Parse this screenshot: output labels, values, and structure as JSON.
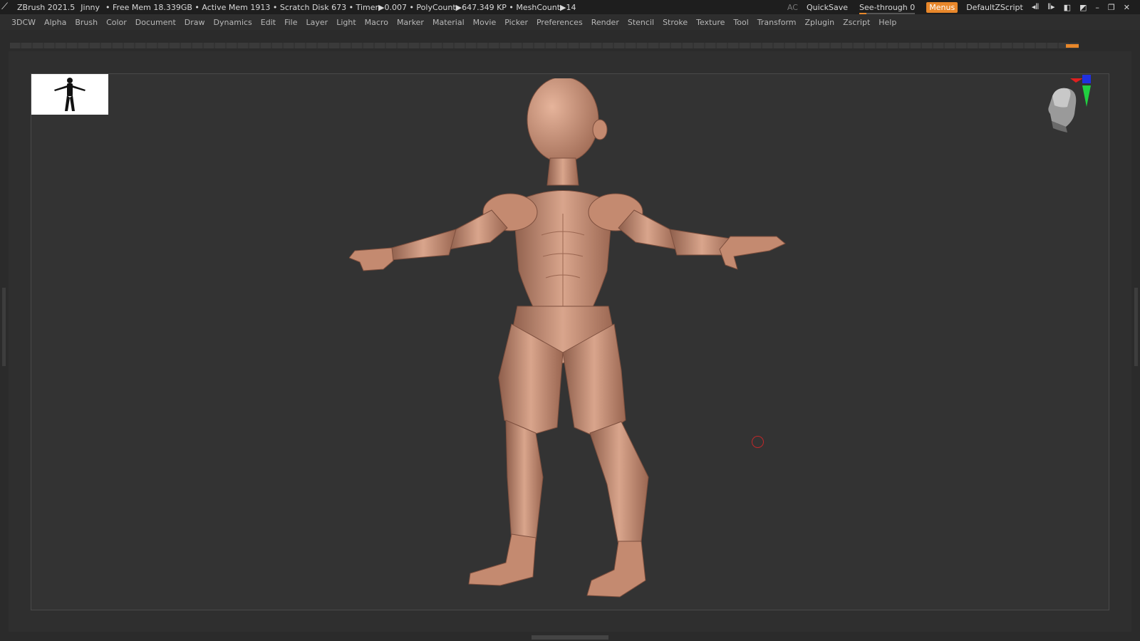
{
  "titlebar": {
    "app_name": "ZBrush 2021.5",
    "user": "Jinny",
    "stats": "• Free Mem 18.339GB • Active Mem 1913 • Scratch Disk 673 • Timer▶0.007 • PolyCount▶647.349 KP • MeshCount▶14",
    "ac": "AC",
    "quicksave": "QuickSave",
    "see_through_label": "See-through",
    "see_through_value": "0",
    "menus": "Menus",
    "script": "DefaultZScript"
  },
  "menubar": {
    "items": [
      "3DCW",
      "Alpha",
      "Brush",
      "Color",
      "Document",
      "Draw",
      "Dynamics",
      "Edit",
      "File",
      "Layer",
      "Light",
      "Macro",
      "Marker",
      "Material",
      "Movie",
      "Picker",
      "Preferences",
      "Render",
      "Stencil",
      "Stroke",
      "Texture",
      "Tool",
      "Transform",
      "Zplugin",
      "Zscript",
      "Help"
    ]
  },
  "colors": {
    "accent": "#e8872a",
    "skin": "#c98f74",
    "canvas": "#333333",
    "background": "#2b2b2b"
  },
  "icons": {
    "app": "zbrush-logo-icon",
    "minimize": "minimize-icon",
    "restore": "restore-icon",
    "close": "close-icon"
  }
}
